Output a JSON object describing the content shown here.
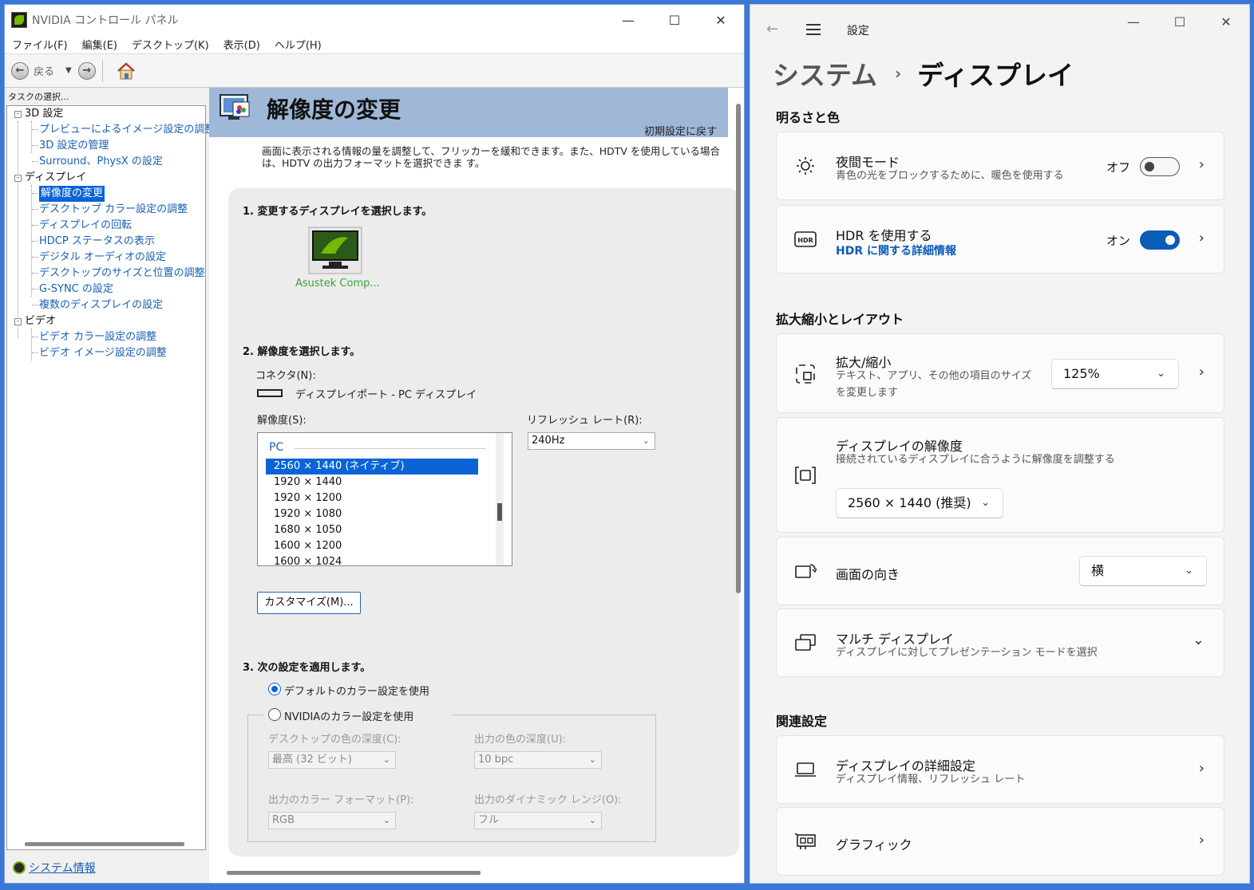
{
  "nvidia": {
    "title": "NVIDIA コントロール パネル",
    "menu": [
      "ファイル(F)",
      "編集(E)",
      "デスクトップ(K)",
      "表示(D)",
      "ヘルプ(H)"
    ],
    "toolbar": {
      "back": "戻る"
    },
    "task_label": "タスクの選択...",
    "tree": {
      "cat_3d": "3D 設定",
      "item_preview": "プレビューによるイメージ設定の調整",
      "item_3dmanage": "3D 設定の管理",
      "item_surround": "Surround、PhysX の設定",
      "cat_display": "ディスプレイ",
      "item_resolution": "解像度の変更",
      "item_desktop_color": "デスクトップ カラー設定の調整",
      "item_rotate": "ディスプレイの回転",
      "item_hdcp": "HDCP ステータスの表示",
      "item_audio": "デジタル オーディオの設定",
      "item_size": "デスクトップのサイズと位置の調整",
      "item_gsync": "G-SYNC の設定",
      "item_multi": "複数のディスプレイの設定",
      "cat_video": "ビデオ",
      "item_video_color": "ビデオ カラー設定の調整",
      "item_video_image": "ビデオ イメージ設定の調整"
    },
    "system_info": "システム情報",
    "page": {
      "title": "解像度の変更",
      "reset": "初期設定に戻す",
      "description": "画面に表示される情報の量を調整して、フリッカーを緩和できます。また、HDTV を使用している場合は、HDTV の出力フォーマットを選択できま す。",
      "step1": "1. 変更するディスプレイを選択します。",
      "monitor_label": "Asustek Comp...",
      "step2": "2. 解像度を選択します。",
      "connector_label": "コネクタ(N):",
      "connector_value": "ディスプレイポート - PC ディスプレイ",
      "resolution_label": "解像度(S):",
      "refresh_label": "リフレッシュ レート(R):",
      "refresh_value": "240Hz",
      "res_group": "PC",
      "resolutions": [
        "2560 × 1440 (ネイティブ)",
        "1920 × 1440",
        "1920 × 1200",
        "1920 × 1080",
        "1680 × 1050",
        "1600 × 1200",
        "1600 × 1024"
      ],
      "customize": "カスタマイズ(M)...",
      "step3": "3. 次の設定を適用します。",
      "radio_default": "デフォルトのカラー設定を使用",
      "radio_nvidia": "NVIDIAのカラー設定を使用",
      "desktop_depth_label": "デスクトップの色の深度(C):",
      "desktop_depth_value": "最高 (32 ビット)",
      "output_depth_label": "出力の色の深度(U):",
      "output_depth_value": "10 bpc",
      "output_format_label": "出力のカラー フォーマット(P):",
      "output_format_value": "RGB",
      "dynamic_range_label": "出力のダイナミック レンジ(O):",
      "dynamic_range_value": "フル"
    }
  },
  "settings": {
    "app_title": "設定",
    "breadcrumb_parent": "システム",
    "breadcrumb_current": "ディスプレイ",
    "section_brightness": "明るさと色",
    "night": {
      "title": "夜間モード",
      "sub": "青色の光をブロックするために、暖色を使用する",
      "state": "オフ"
    },
    "hdr": {
      "title": "HDR を使用する",
      "link": "HDR に関する詳細情報",
      "state": "オン"
    },
    "section_scale": "拡大縮小とレイアウト",
    "scale": {
      "title": "拡大/縮小",
      "sub": "テキスト、アプリ、その他の項目のサイズを変更します",
      "value": "125%"
    },
    "resolution": {
      "title": "ディスプレイの解像度",
      "sub": "接続されているディスプレイに合うように解像度を調整する",
      "value": "2560 × 1440 (推奨)"
    },
    "orientation": {
      "title": "画面の向き",
      "value": "横"
    },
    "multi": {
      "title": "マルチ ディスプレイ",
      "sub": "ディスプレイに対してプレゼンテーション モードを選択"
    },
    "section_related": "関連設定",
    "advanced": {
      "title": "ディスプレイの詳細設定",
      "sub": "ディスプレイ情報、リフレッシュ レート"
    },
    "graphics": {
      "title": "グラフィック"
    }
  }
}
